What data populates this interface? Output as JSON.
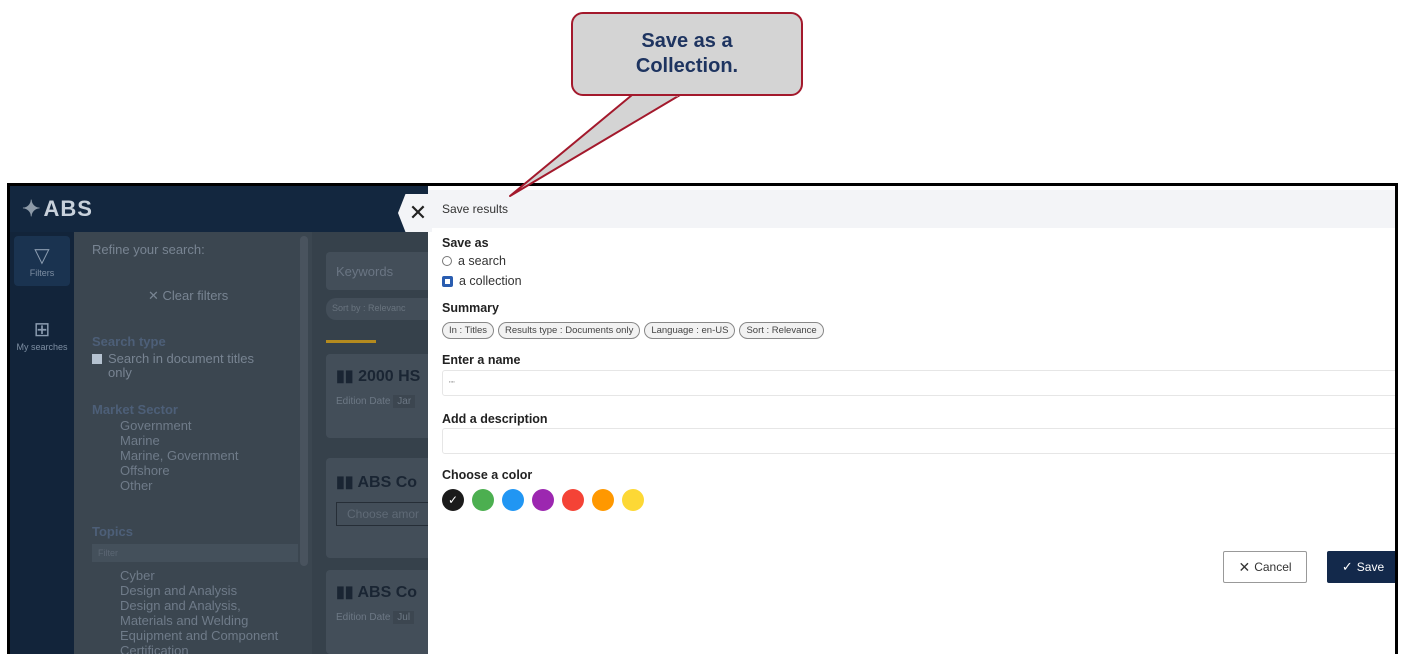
{
  "callout": {
    "line1": "Save as a",
    "line2": "Collection."
  },
  "app": {
    "logo": "ABS",
    "rail": [
      {
        "label": "Filters",
        "icon": "filter-icon"
      },
      {
        "label": "My searches",
        "icon": "grid-search-icon"
      }
    ],
    "refine": {
      "title": "Refine your search:",
      "clear": "Clear filters",
      "search_type": "Search type",
      "search_titles_only_line1": "Search in document titles",
      "search_titles_only_line2": "only",
      "market_sector": "Market Sector",
      "sectors": [
        "Government",
        "Marine",
        "Marine, Government",
        "Offshore",
        "Other"
      ],
      "topics": "Topics",
      "topics_filter_placeholder": "Filter",
      "topic_items": [
        "Cyber",
        "Design and Analysis",
        "Design and Analysis,",
        "Materials and Welding",
        "Equipment and Component",
        "Certification"
      ]
    },
    "results": {
      "keywords_placeholder": "Keywords",
      "sort": "Sort by : Relevanc",
      "card1_title": "2000 HS",
      "card1_meta": "Edition Date",
      "card1_date": "Jar",
      "card2_title": "ABS Co",
      "card2_choose": "Choose amor",
      "card3_title": "ABS Co",
      "card3_meta": "Edition Date",
      "card3_date": "Jul"
    }
  },
  "modal": {
    "title": "Save results",
    "save_as_label": "Save as",
    "option_search": "a search",
    "option_collection": "a collection",
    "summary_label": "Summary",
    "chips": [
      "In : Titles",
      "Results type : Documents only",
      "Language : en-US",
      "Sort : Relevance"
    ],
    "name_label": "Enter a name",
    "name_value": "\"\"",
    "description_label": "Add a description",
    "description_value": "",
    "color_label": "Choose a color",
    "colors": [
      "#1b1b1b",
      "#4caf50",
      "#2196f3",
      "#9c27b0",
      "#f44336",
      "#ff9800",
      "#fdd835"
    ],
    "selected_color_index": 0,
    "cancel_label": "Cancel",
    "save_label": "Save"
  }
}
